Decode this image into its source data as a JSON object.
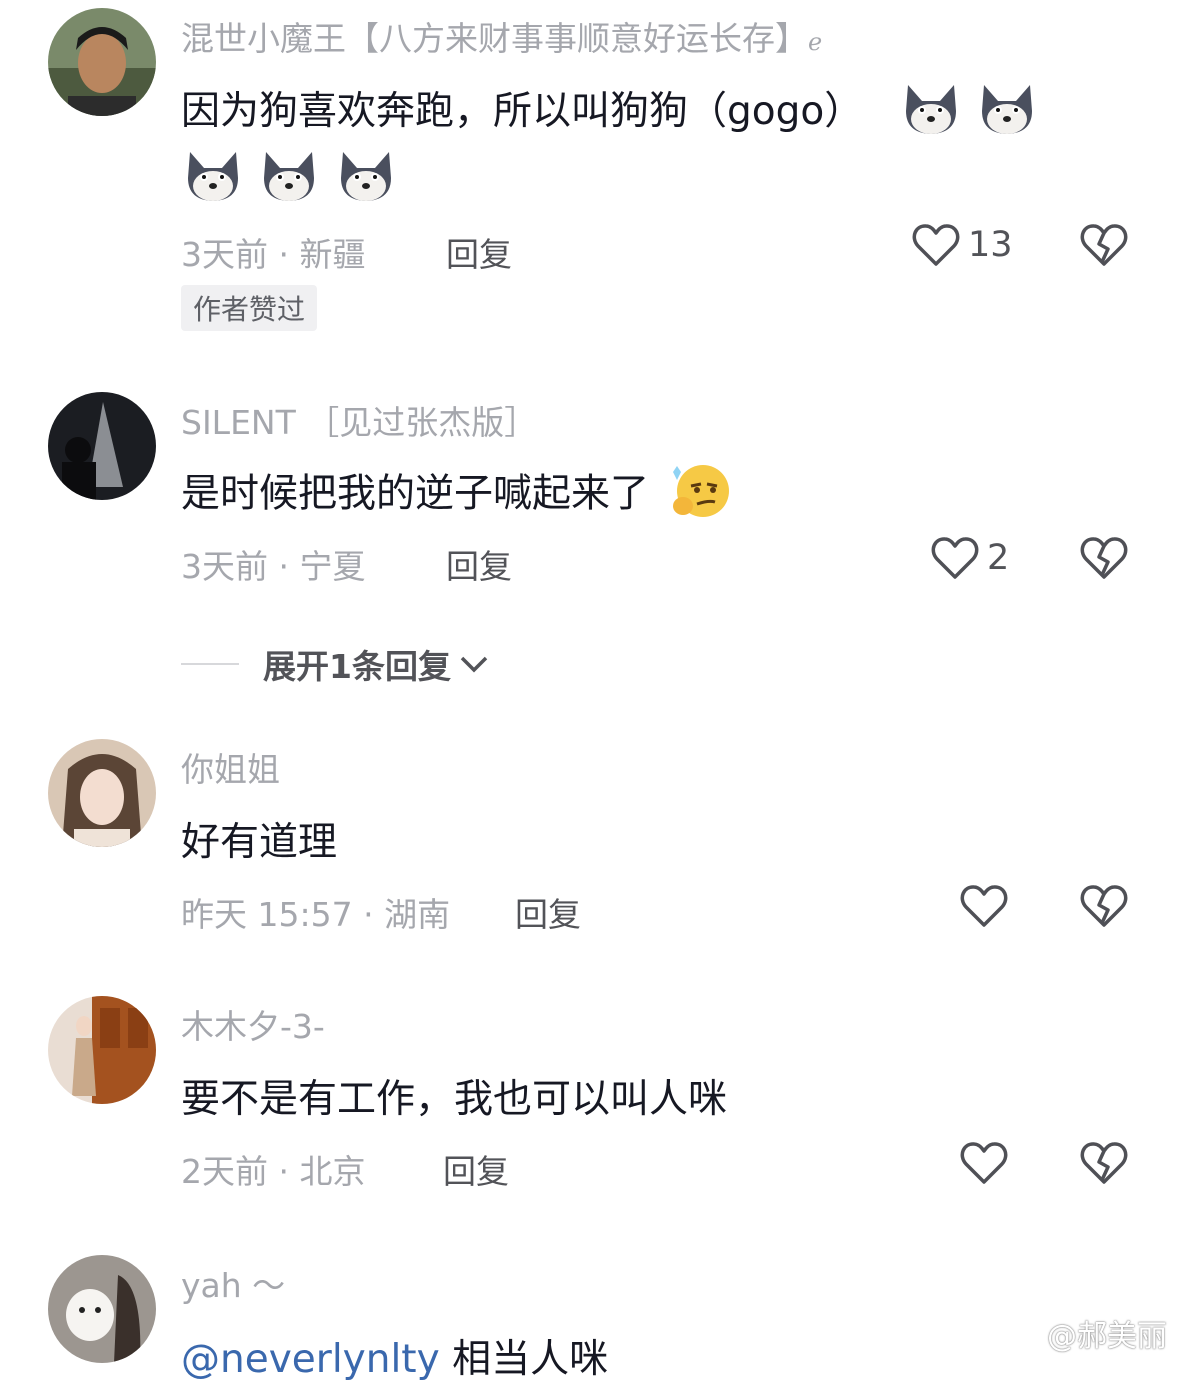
{
  "comments": [
    {
      "username": "混世小魔王【八方来财事事顺意好运长存】",
      "username_suffix_icon": "ornament-icon",
      "text": "因为狗喜欢奔跑，所以叫狗狗（gogo）",
      "emojis": [
        "husky-emoji",
        "husky-emoji",
        "husky-emoji",
        "husky-emoji",
        "husky-emoji"
      ],
      "time": "3天前",
      "location": "新疆",
      "reply_label": "回复",
      "likes": "13",
      "badge": "作者赞过"
    },
    {
      "username": "SILENT ［见过张杰版］",
      "text": "是时候把我的逆子喊起来了",
      "emojis": [
        "thinking-smirk-emoji"
      ],
      "time": "3天前",
      "location": "宁夏",
      "reply_label": "回复",
      "likes": "2",
      "expand_label": "展开1条回复"
    },
    {
      "username": "你姐姐",
      "text": "好有道理",
      "time": "昨天 15:57",
      "location": "湖南",
      "reply_label": "回复",
      "likes": ""
    },
    {
      "username": "木木夕-3-",
      "text": "要不是有工作，我也可以叫人咪",
      "time": "2天前",
      "location": "北京",
      "reply_label": "回复",
      "likes": ""
    },
    {
      "username": "yah ～",
      "mention": "@neverlynlty",
      "text": " 相当人咪"
    }
  ],
  "watermark": "@郝美丽",
  "colors": {
    "meta_gray": "#a5a7ad",
    "text_dark": "#161823",
    "mention_blue": "#3a68ad",
    "badge_bg": "#f0f0f2"
  }
}
